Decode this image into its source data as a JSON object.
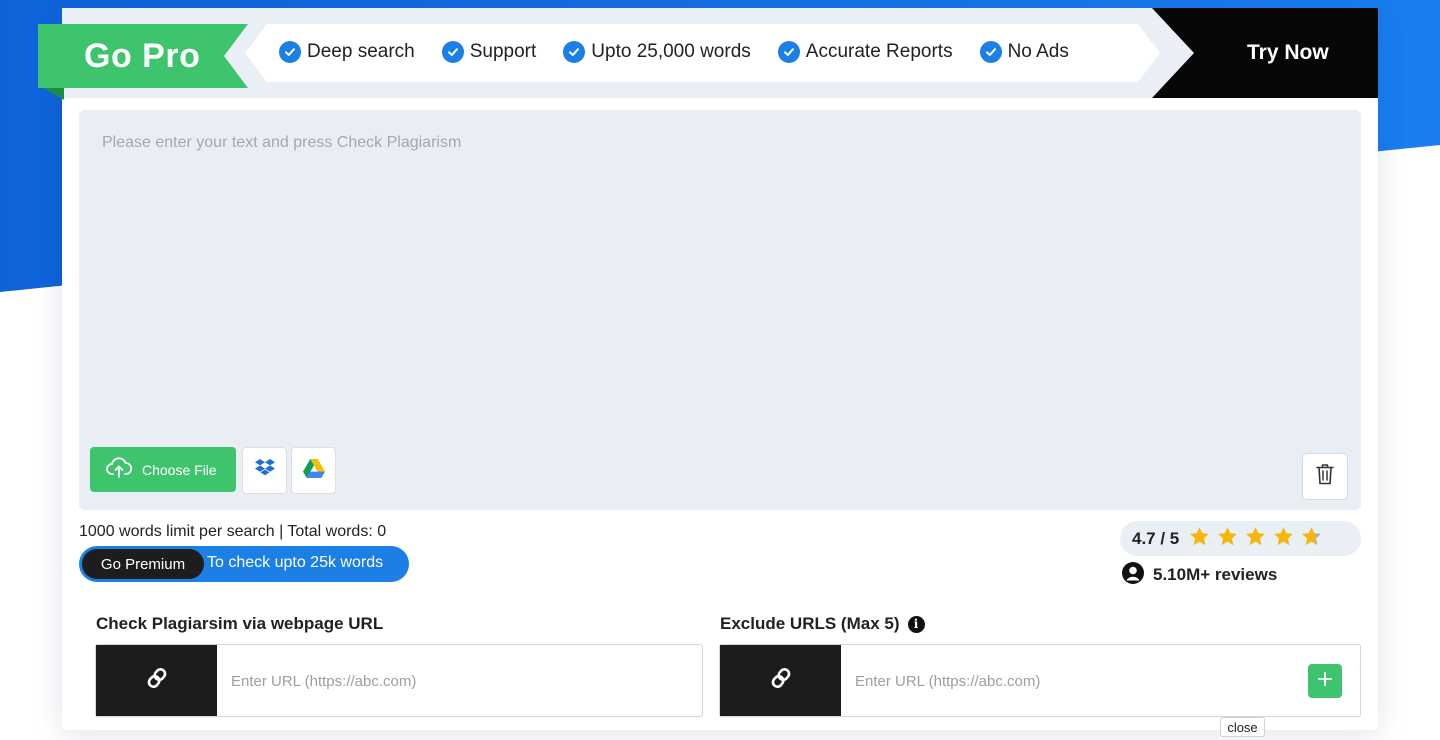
{
  "colors": {
    "brand_blue": "#1c7fe6",
    "brand_green": "#3ec46d",
    "dark": "#1c1c1c",
    "editor_bg": "#e9eef5",
    "star": "#f5b50a"
  },
  "promo": {
    "go_pro": "Go Pro",
    "features": [
      "Deep search",
      "Support",
      "Upto 25,000 words",
      "Accurate Reports",
      "No Ads"
    ],
    "feature_icon": "check-circle-icon",
    "try_now": "Try Now"
  },
  "editor": {
    "placeholder": "Please enter your text and press Check Plagiarism",
    "value": "",
    "choose_file": "Choose File",
    "choose_file_icon": "cloud-upload-icon",
    "dropbox_icon": "dropbox-icon",
    "drive_icon": "google-drive-icon",
    "delete_icon": "trash-icon"
  },
  "stats": {
    "limit_text": "1000 words limit per search | Total words: 0"
  },
  "premium": {
    "button": "Go Premium",
    "text": "To check upto 25k words"
  },
  "rating": {
    "score_text": "4.7 / 5",
    "value": 4.7,
    "max": 5,
    "reviews": "5.10M+ reviews",
    "reviews_icon": "user-circle-icon"
  },
  "url_check": {
    "label": "Check Plagiarsim via webpage URL",
    "placeholder": "Enter URL (https://abc.com)",
    "icon": "link-icon"
  },
  "exclude": {
    "label": "Exclude URLS (Max 5)",
    "info_icon": "info-icon",
    "placeholder": "Enter URL (https://abc.com)",
    "icon": "link-icon",
    "add_icon": "plus-icon"
  },
  "close_label": "close"
}
